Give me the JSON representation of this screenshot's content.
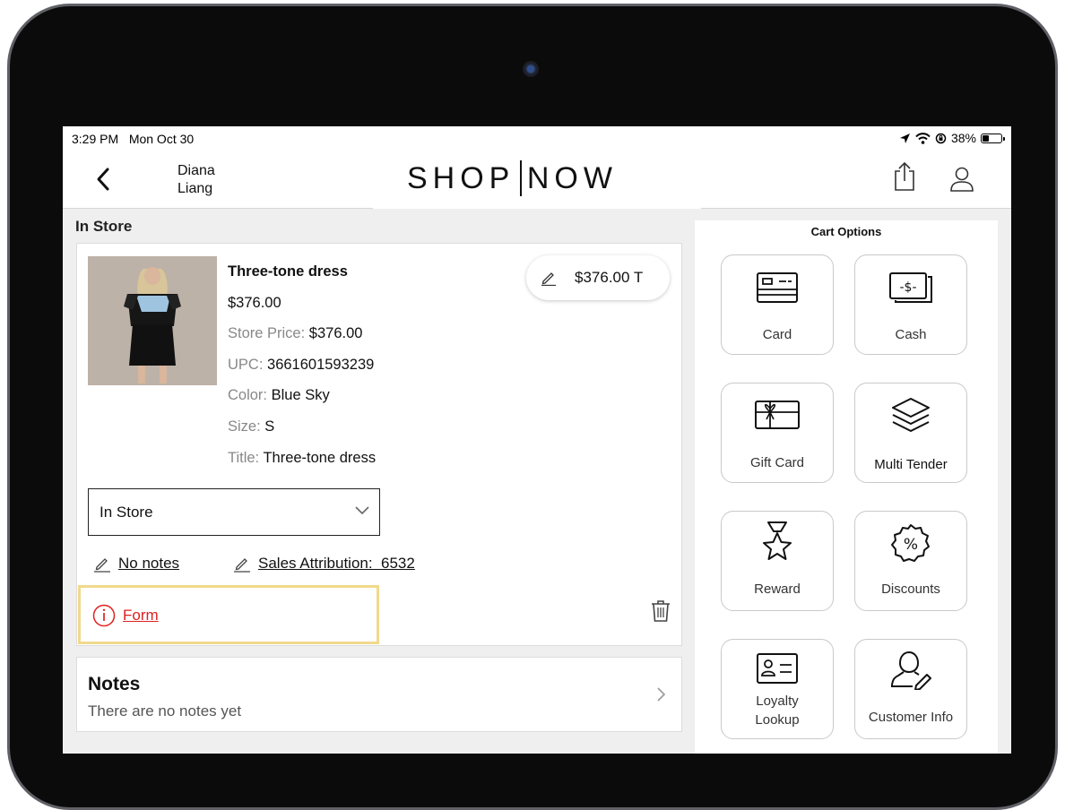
{
  "status": {
    "time": "3:29 PM",
    "date": "Mon Oct 30",
    "battery": "38%",
    "battery_level": 0.38
  },
  "nav": {
    "user_first": "Diana",
    "user_last": "Liang",
    "brand_left": "SHOP",
    "brand_right": "NOW"
  },
  "section_title": "In Store",
  "item": {
    "name": "Three-tone dress",
    "price": "$376.00",
    "store_price_label": "Store Price:",
    "store_price": "$376.00",
    "upc_label": "UPC:",
    "upc": "3661601593239",
    "color_label": "Color:",
    "color": "Blue Sky",
    "size_label": "Size:",
    "size": "S",
    "title_label": "Title:",
    "title": "Three-tone dress",
    "price_pill": "$376.00 T",
    "fulfillment": "In Store",
    "notes_link": "No notes",
    "attribution_link": "Sales Attribution:  6532",
    "form_link": "Form"
  },
  "notes": {
    "title": "Notes",
    "empty": "There are no notes yet"
  },
  "cart": {
    "title": "Cart Options",
    "options": [
      {
        "label": "Card",
        "icon": "card-icon"
      },
      {
        "label": "Cash",
        "icon": "cash-icon"
      },
      {
        "label": "Gift Card",
        "icon": "gift-card-icon"
      },
      {
        "label": "Multi Tender",
        "icon": "layers-icon"
      },
      {
        "label": "Reward",
        "icon": "medal-star-icon"
      },
      {
        "label": "Discounts",
        "icon": "discount-badge-icon"
      },
      {
        "label1": "Loyalty",
        "label2": "Lookup",
        "icon": "id-card-icon"
      },
      {
        "label": "Customer Info",
        "icon": "customer-edit-icon"
      }
    ]
  },
  "colors": {
    "error": "#e02020",
    "highlight": "#f0d98c",
    "panel_bg": "#efefef"
  }
}
